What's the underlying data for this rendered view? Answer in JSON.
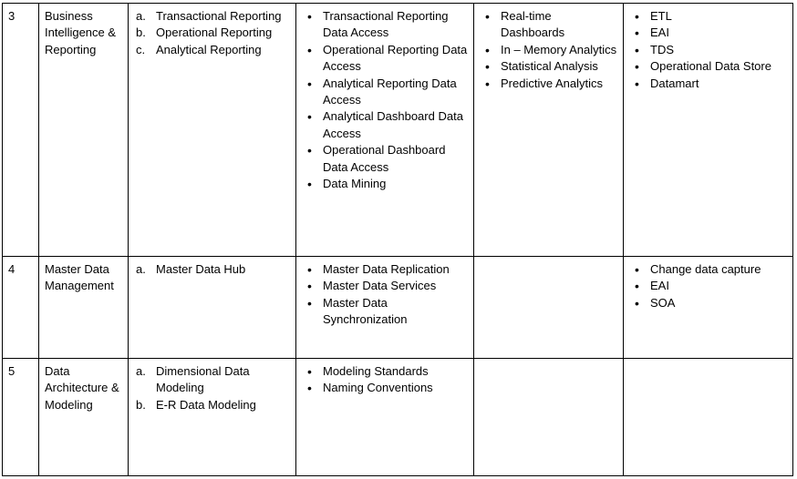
{
  "rows": [
    {
      "number": "3",
      "area": "Business Intelligence & Reporting",
      "capabilities": [
        {
          "marker": "a.",
          "text": "Transactional Reporting"
        },
        {
          "marker": "b.",
          "text": "Operational Reporting"
        },
        {
          "marker": "c.",
          "text": "Analytical Reporting"
        }
      ],
      "services": [
        "Transactional Reporting Data Access",
        "Operational Reporting Data Access",
        "Analytical Reporting Data Access",
        "Analytical Dashboard Data Access",
        "Operational Dashboard Data Access",
        "Data Mining"
      ],
      "analytics": [
        "Real-time Dashboards",
        "In – Memory Analytics",
        "Statistical Analysis",
        "Predictive Analytics"
      ],
      "technologies": [
        "ETL",
        "EAI",
        "TDS",
        "Operational Data Store",
        "Datamart"
      ]
    },
    {
      "number": "4",
      "area": "Master Data Management",
      "capabilities": [
        {
          "marker": "a.",
          "text": "Master Data Hub"
        }
      ],
      "services": [
        "Master Data Replication",
        "Master Data Services",
        "Master Data Synchronization"
      ],
      "analytics": [],
      "technologies": [
        "Change data capture",
        "EAI",
        "SOA"
      ]
    },
    {
      "number": "5",
      "area": "Data Architecture & Modeling",
      "capabilities": [
        {
          "marker": "a.",
          "text": "Dimensional Data Modeling"
        },
        {
          "marker": "b.",
          "text": "E-R Data Modeling"
        }
      ],
      "services": [
        "Modeling Standards",
        "Naming Conventions"
      ],
      "analytics": [],
      "technologies": []
    }
  ]
}
